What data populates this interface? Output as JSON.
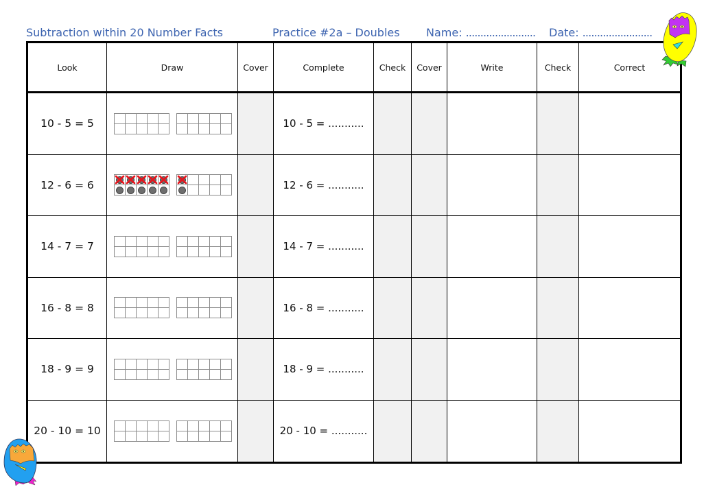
{
  "header": {
    "title": "Subtraction within 20 Number Facts",
    "practice": "Practice #2a – Doubles",
    "name_label": "Name:",
    "name_blank": "........................",
    "date_label": "Date:",
    "date_blank": "........................"
  },
  "colors": {
    "title": "#3d64b0",
    "shade": "#f1f1f1",
    "cross": "#e8141c",
    "counter": "#6e6e6e"
  },
  "table": {
    "columns": [
      "Look",
      "Draw",
      "Cover",
      "Complete",
      "Check",
      "Cover",
      "Write",
      "Check",
      "Correct"
    ],
    "rows": [
      {
        "look": "10 - 5 = 5",
        "complete": "10 - 5 = ...........",
        "draw": [
          [
            "",
            "",
            "",
            "",
            "",
            "",
            "",
            "",
            "",
            ""
          ],
          [
            "",
            "",
            "",
            "",
            "",
            "",
            "",
            "",
            "",
            ""
          ]
        ]
      },
      {
        "look": "12 - 6 = 6",
        "complete": "12 - 6 = ...........",
        "draw": [
          [
            "x",
            "x",
            "x",
            "x",
            "x",
            "o",
            "o",
            "o",
            "o",
            "o"
          ],
          [
            "x",
            "",
            "",
            "",
            "",
            "o",
            "",
            "",
            "",
            ""
          ]
        ]
      },
      {
        "look": "14 - 7 = 7",
        "complete": "14 - 7 = ...........",
        "draw": [
          [
            "",
            "",
            "",
            "",
            "",
            "",
            "",
            "",
            "",
            ""
          ],
          [
            "",
            "",
            "",
            "",
            "",
            "",
            "",
            "",
            "",
            ""
          ]
        ]
      },
      {
        "look": "16 - 8 = 8",
        "complete": "16 - 8 = ...........",
        "draw": [
          [
            "",
            "",
            "",
            "",
            "",
            "",
            "",
            "",
            "",
            ""
          ],
          [
            "",
            "",
            "",
            "",
            "",
            "",
            "",
            "",
            "",
            ""
          ]
        ]
      },
      {
        "look": "18 - 9 = 9",
        "complete": "18 - 9 = ...........",
        "draw": [
          [
            "",
            "",
            "",
            "",
            "",
            "",
            "",
            "",
            "",
            ""
          ],
          [
            "",
            "",
            "",
            "",
            "",
            "",
            "",
            "",
            "",
            ""
          ]
        ]
      },
      {
        "look": "20 - 10 = 10",
        "complete": "20 - 10 = ...........",
        "draw": [
          [
            "",
            "",
            "",
            "",
            "",
            "",
            "",
            "",
            "",
            ""
          ],
          [
            "",
            "",
            "",
            "",
            "",
            "",
            "",
            "",
            "",
            ""
          ]
        ]
      }
    ]
  },
  "decorations": [
    "yellow-monster",
    "blue-monster"
  ]
}
